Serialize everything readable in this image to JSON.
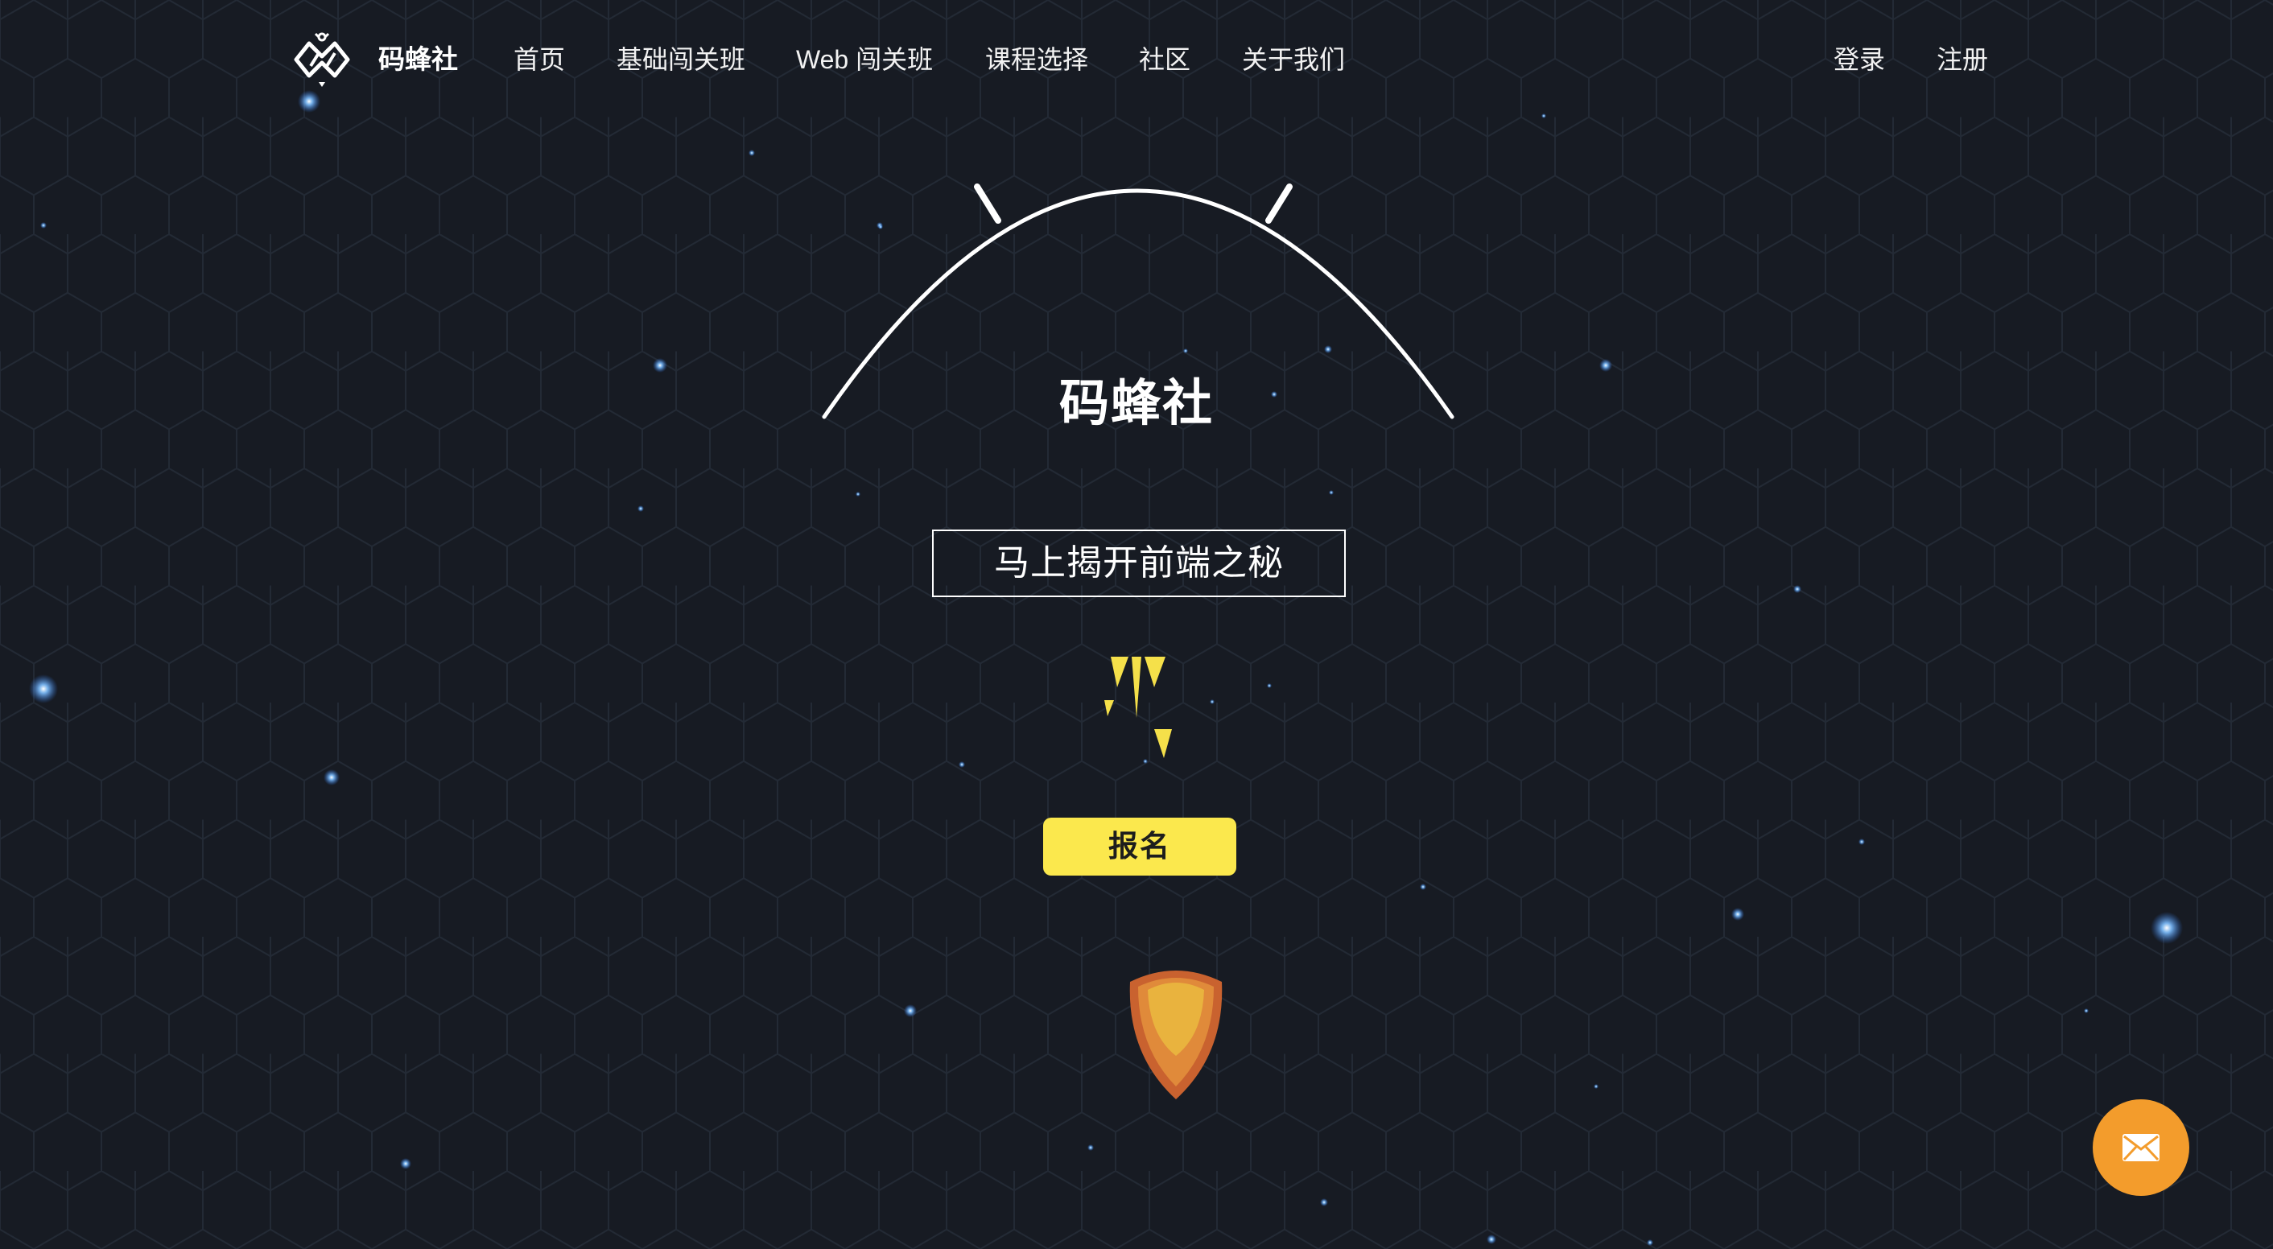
{
  "nav": {
    "logo_icon": "bee-hexagon-logo-icon",
    "brand": "码蜂社",
    "items": [
      {
        "label": "首页"
      },
      {
        "label": "基础闯关班"
      },
      {
        "label": "Web 闯关班"
      },
      {
        "label": "课程选择"
      },
      {
        "label": "社区"
      },
      {
        "label": "关于我们"
      }
    ],
    "login": "登录",
    "register": "注册"
  },
  "hero": {
    "title": "码蜂社",
    "reveal_button": "马上揭开前端之秘",
    "signup_button": "报名",
    "bolt_icon": "lightning-bolt-icon",
    "flame_icon": "rocket-flame-icon"
  },
  "floating": {
    "mail_icon": "envelope-icon"
  },
  "colors": {
    "background": "#171b23",
    "hex_grid": "#222833",
    "accent_yellow": "#fbe84d",
    "mail_orange": "#f39c2c",
    "flame_outer": "#c9622f",
    "flame_inner": "#e9b33e",
    "star_blue": "#5aa8ff"
  }
}
